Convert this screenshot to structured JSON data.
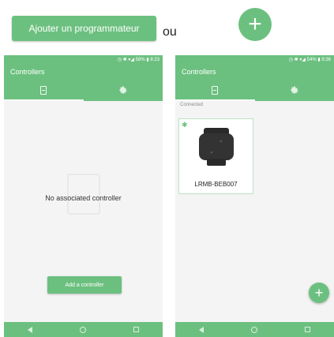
{
  "header": {
    "add_programmer_label": "Ajouter un programmateur",
    "or_label": "ou",
    "fab_plus": "+"
  },
  "phone_left": {
    "status_text": "◷ ✱ ▾◢ 58% ▮ 8:23",
    "title": "Controllers",
    "empty_message": "No associated controller",
    "add_button_label": "Add a controller"
  },
  "phone_right": {
    "status_text": "◷ ✱ ▾◢ 54% ▮ 9:36",
    "title": "Controllers",
    "section_label": "Connected",
    "device_name": "LRMB-BEB007",
    "fab_plus": "+"
  },
  "colors": {
    "accent": "#6cc07f"
  },
  "icons": [
    "device-tab-icon",
    "gear-icon",
    "bluetooth-icon",
    "plus-icon",
    "nav-back-icon",
    "nav-home-icon",
    "nav-recent-icon"
  ]
}
